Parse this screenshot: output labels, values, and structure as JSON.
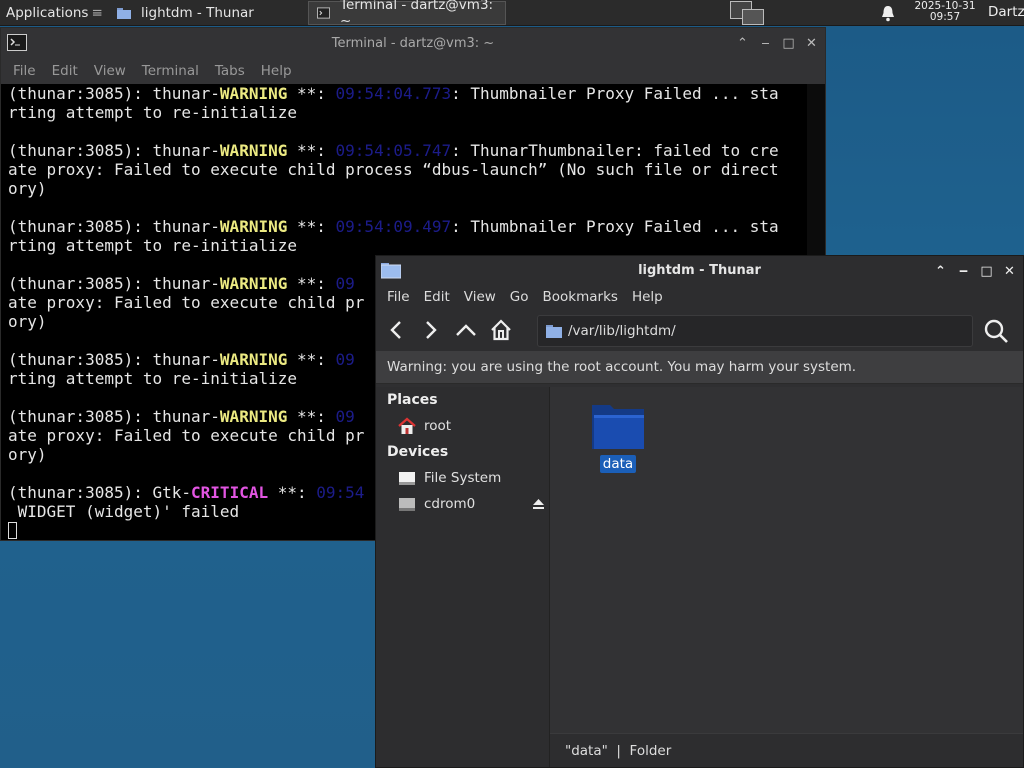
{
  "panel": {
    "apps_label": "Applications",
    "tasks": [
      {
        "label": "lightdm - Thunar"
      },
      {
        "label": "Terminal - dartz@vm3: ~"
      }
    ],
    "clock_date": "2025-10-31",
    "clock_time": "09:57",
    "user": "Dartz"
  },
  "terminal": {
    "title": "Terminal - dartz@vm3: ~",
    "menu": [
      "File",
      "Edit",
      "View",
      "Terminal",
      "Tabs",
      "Help"
    ],
    "lines": [
      {
        "pre": "(thunar:3085): thunar-",
        "tag": "WARNING",
        "kind": "warn",
        "mid": " **: ",
        "ts": "09:54:04.773",
        "post": ": Thumbnailer Proxy Failed ... sta"
      },
      {
        "pre": "rting attempt to re-initialize",
        "tag": "",
        "kind": "",
        "mid": "",
        "ts": "",
        "post": ""
      },
      {
        "pre": "",
        "tag": "",
        "kind": "",
        "mid": "",
        "ts": "",
        "post": ""
      },
      {
        "pre": "(thunar:3085): thunar-",
        "tag": "WARNING",
        "kind": "warn",
        "mid": " **: ",
        "ts": "09:54:05.747",
        "post": ": ThunarThumbnailer: failed to cre"
      },
      {
        "pre": "ate proxy: Failed to execute child process “dbus-launch” (No such file or direct",
        "tag": "",
        "kind": "",
        "mid": "",
        "ts": "",
        "post": ""
      },
      {
        "pre": "ory)",
        "tag": "",
        "kind": "",
        "mid": "",
        "ts": "",
        "post": ""
      },
      {
        "pre": "",
        "tag": "",
        "kind": "",
        "mid": "",
        "ts": "",
        "post": ""
      },
      {
        "pre": "(thunar:3085): thunar-",
        "tag": "WARNING",
        "kind": "warn",
        "mid": " **: ",
        "ts": "09:54:09.497",
        "post": ": Thumbnailer Proxy Failed ... sta"
      },
      {
        "pre": "rting attempt to re-initialize",
        "tag": "",
        "kind": "",
        "mid": "",
        "ts": "",
        "post": ""
      },
      {
        "pre": "",
        "tag": "",
        "kind": "",
        "mid": "",
        "ts": "",
        "post": ""
      },
      {
        "pre": "(thunar:3085): thunar-",
        "tag": "WARNING",
        "kind": "warn",
        "mid": " **: ",
        "ts": "09",
        "post": ""
      },
      {
        "pre": "ate proxy: Failed to execute child pr",
        "tag": "",
        "kind": "",
        "mid": "",
        "ts": "",
        "post": ""
      },
      {
        "pre": "ory)",
        "tag": "",
        "kind": "",
        "mid": "",
        "ts": "",
        "post": ""
      },
      {
        "pre": "",
        "tag": "",
        "kind": "",
        "mid": "",
        "ts": "",
        "post": ""
      },
      {
        "pre": "(thunar:3085): thunar-",
        "tag": "WARNING",
        "kind": "warn",
        "mid": " **: ",
        "ts": "09",
        "post": ""
      },
      {
        "pre": "rting attempt to re-initialize",
        "tag": "",
        "kind": "",
        "mid": "",
        "ts": "",
        "post": ""
      },
      {
        "pre": "",
        "tag": "",
        "kind": "",
        "mid": "",
        "ts": "",
        "post": ""
      },
      {
        "pre": "(thunar:3085): thunar-",
        "tag": "WARNING",
        "kind": "warn",
        "mid": " **: ",
        "ts": "09",
        "post": ""
      },
      {
        "pre": "ate proxy: Failed to execute child pr",
        "tag": "",
        "kind": "",
        "mid": "",
        "ts": "",
        "post": ""
      },
      {
        "pre": "ory)",
        "tag": "",
        "kind": "",
        "mid": "",
        "ts": "",
        "post": ""
      },
      {
        "pre": "",
        "tag": "",
        "kind": "",
        "mid": "",
        "ts": "",
        "post": ""
      },
      {
        "pre": "(thunar:3085): Gtk-",
        "tag": "CRITICAL",
        "kind": "crit",
        "mid": " **: ",
        "ts": "09:54",
        "post": ""
      },
      {
        "pre": " WIDGET (widget)' failed",
        "tag": "",
        "kind": "",
        "mid": "",
        "ts": "",
        "post": ""
      }
    ]
  },
  "thunar": {
    "title": "lightdm - Thunar",
    "menu": [
      "File",
      "Edit",
      "View",
      "Go",
      "Bookmarks",
      "Help"
    ],
    "location": "/var/lib/lightdm/",
    "warning": "Warning: you are using the root account. You may harm your system.",
    "places_heading": "Places",
    "places": [
      {
        "label": "root"
      }
    ],
    "devices_heading": "Devices",
    "devices": [
      {
        "label": "File System"
      },
      {
        "label": "cdrom0"
      }
    ],
    "items": [
      {
        "label": "data"
      }
    ],
    "status": "\"data\"  |  Folder"
  },
  "colors": {
    "warning_tag": "#ecea82",
    "critical_tag": "#e255e2",
    "selection": "#1b5fb8",
    "desktop": "#1f6390"
  }
}
